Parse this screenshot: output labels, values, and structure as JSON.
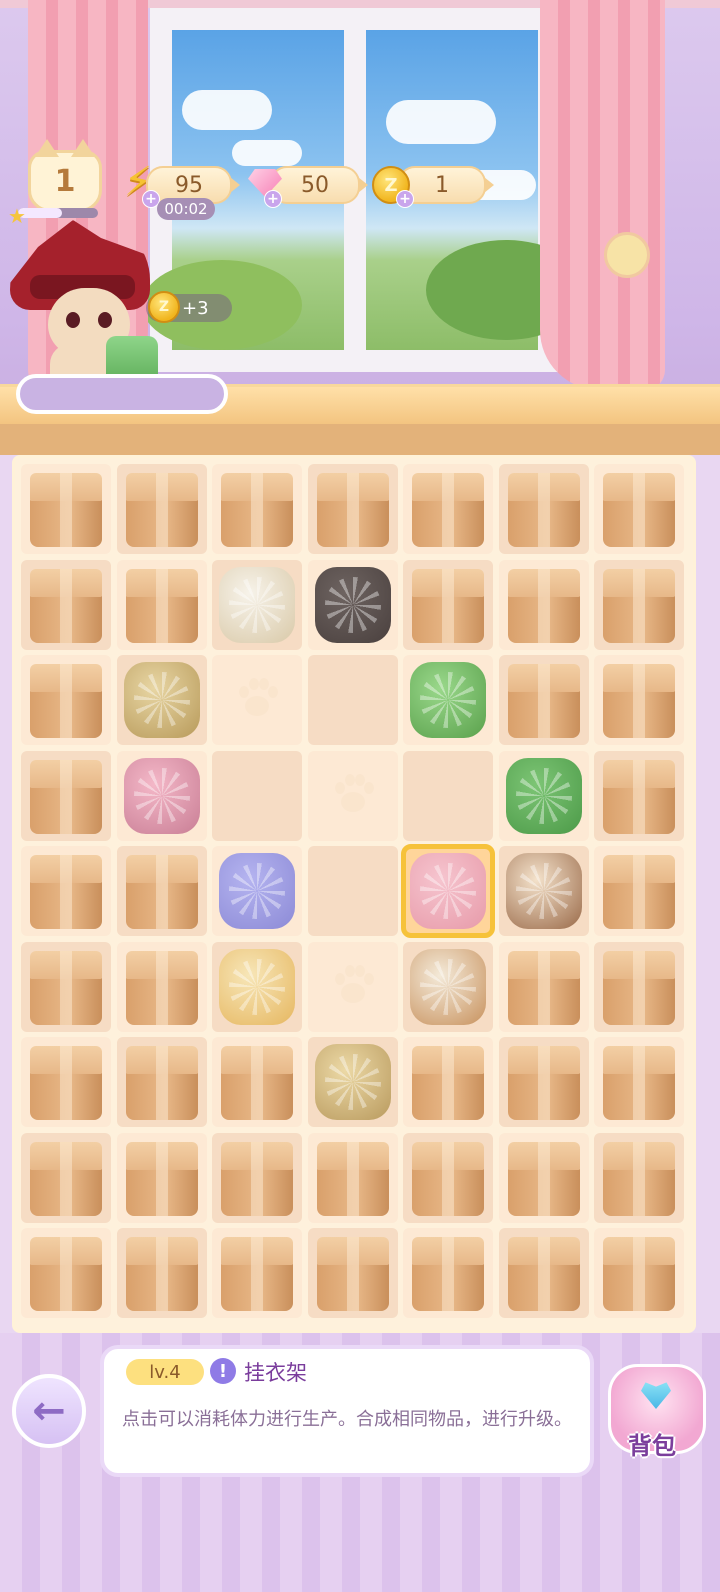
{
  "hud": {
    "player_level": "1",
    "xp_progress": 0.55,
    "energy": "95",
    "energy_timer": "00:02",
    "gems": "50",
    "coins": "1",
    "coin_bonus": "+3"
  },
  "colors": {
    "board_bg": "#fef1dc",
    "selected_outline": "#f6c23a",
    "accent_purple": "#8f7be6"
  },
  "board": {
    "rows": 9,
    "cols": 7,
    "grid": [
      [
        "box",
        "box",
        "box",
        "box",
        "box",
        "box",
        "box"
      ],
      [
        "box",
        "box",
        "pitcher",
        "cat",
        "box",
        "box",
        "box"
      ],
      [
        "box",
        "dress-bag",
        "empty",
        "empty",
        "green-bow",
        "box",
        "box"
      ],
      [
        "box",
        "pink-cloth",
        "empty",
        "empty",
        "empty",
        "green-sweater",
        "box"
      ],
      [
        "box",
        "box",
        "blue-jacket",
        "empty",
        "hanger",
        "coffee-cup",
        "box"
      ],
      [
        "box",
        "box",
        "tea-mug",
        "empty",
        "bottle",
        "box",
        "box"
      ],
      [
        "box",
        "box",
        "box",
        "rabbit-bag",
        "box",
        "box",
        "box"
      ],
      [
        "box",
        "box",
        "box",
        "box",
        "box",
        "box",
        "box"
      ],
      [
        "box",
        "box",
        "box",
        "box",
        "box",
        "box",
        "box"
      ]
    ],
    "paw_cells": [
      [
        2,
        2
      ],
      [
        3,
        3
      ],
      [
        5,
        3
      ]
    ],
    "selected_cell": [
      4,
      4
    ]
  },
  "info": {
    "level_tag": "lv.4",
    "item_name": "挂衣架",
    "description": "点击可以消耗体力进行生产。合成相同物品，进行升级。"
  },
  "buttons": {
    "bag_label": "背包"
  }
}
